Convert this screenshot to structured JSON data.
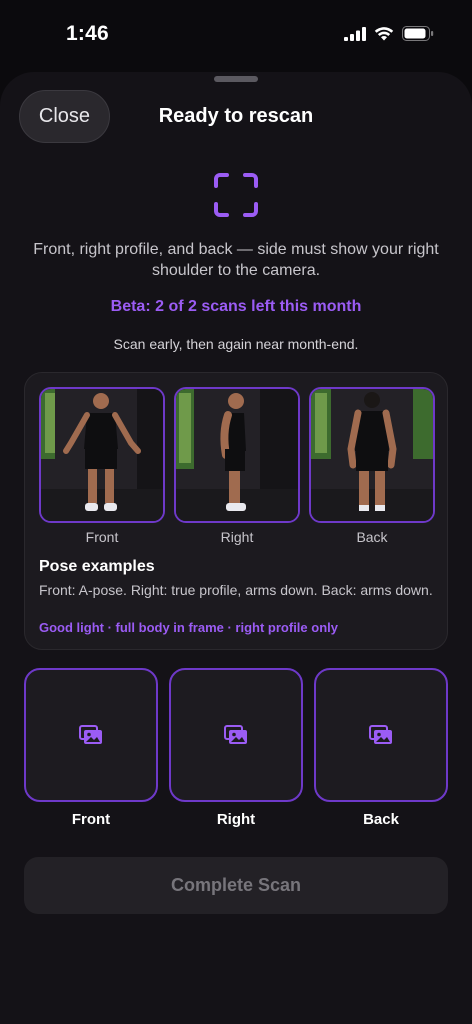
{
  "status_bar": {
    "time": "1:46"
  },
  "sheet": {
    "close_label": "Close",
    "title": "Ready to rescan"
  },
  "intro": {
    "description": "Front, right profile, and back — side must show your right shoulder to the camera.",
    "beta": "Beta: 2 of 2 scans left this month",
    "hint": "Scan early, then again near month-end."
  },
  "pose_examples": {
    "thumbnails": [
      {
        "label": "Front"
      },
      {
        "label": "Right"
      },
      {
        "label": "Back"
      }
    ],
    "title": "Pose examples",
    "text": "Front: A-pose. Right: true profile, arms down. Back: arms down.",
    "tips": "Good light · full body in frame · right profile only"
  },
  "upload_slots": [
    {
      "label": "Front",
      "icon": "image-icon"
    },
    {
      "label": "Right",
      "icon": "image-icon"
    },
    {
      "label": "Back",
      "icon": "image-icon"
    }
  ],
  "complete_button": {
    "label": "Complete Scan"
  },
  "colors": {
    "accent": "#9b5cf4",
    "border_accent": "#6e39c9",
    "sheet_bg": "#141217",
    "page_bg": "#0b0a0d"
  }
}
